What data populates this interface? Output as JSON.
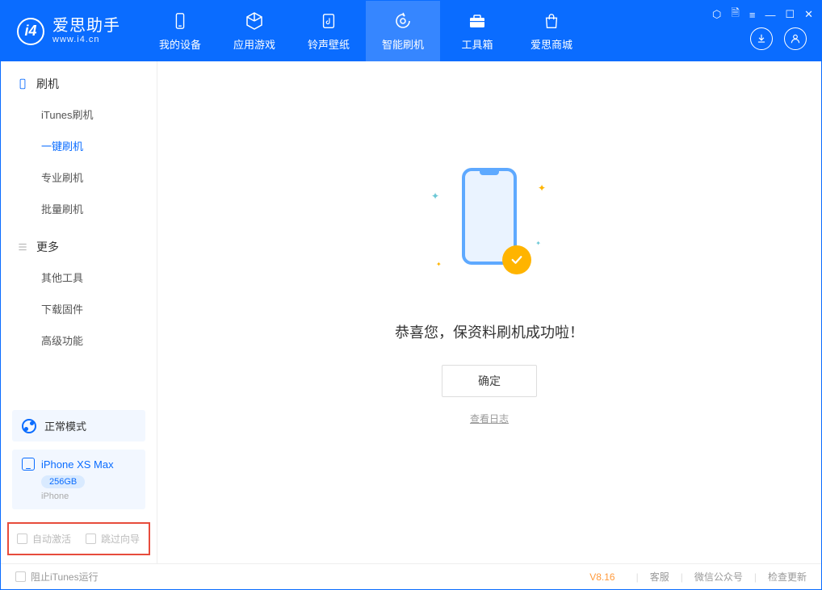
{
  "app": {
    "logo_title": "爱思助手",
    "logo_sub": "www.i4.cn"
  },
  "tabs": [
    {
      "label": "我的设备",
      "icon": "device"
    },
    {
      "label": "应用游戏",
      "icon": "cube"
    },
    {
      "label": "铃声壁纸",
      "icon": "music"
    },
    {
      "label": "智能刷机",
      "icon": "refresh"
    },
    {
      "label": "工具箱",
      "icon": "toolbox"
    },
    {
      "label": "爱思商城",
      "icon": "bag"
    }
  ],
  "active_tab": 3,
  "sidebar": {
    "sections": [
      {
        "title": "刷机",
        "icon": "phone",
        "items": [
          "iTunes刷机",
          "一键刷机",
          "专业刷机",
          "批量刷机"
        ],
        "active": 1
      },
      {
        "title": "更多",
        "icon": "menu",
        "items": [
          "其他工具",
          "下载固件",
          "高级功能"
        ],
        "active": -1
      }
    ],
    "mode_label": "正常模式",
    "device": {
      "name": "iPhone XS Max",
      "capacity": "256GB",
      "type": "iPhone"
    },
    "checks": {
      "auto_activate": "自动激活",
      "skip_guide": "跳过向导"
    }
  },
  "main": {
    "success_msg": "恭喜您，保资料刷机成功啦！",
    "ok_button": "确定",
    "log_link": "查看日志"
  },
  "footer": {
    "block_itunes": "阻止iTunes运行",
    "version": "V8.16",
    "links": [
      "客服",
      "微信公众号",
      "检查更新"
    ]
  }
}
